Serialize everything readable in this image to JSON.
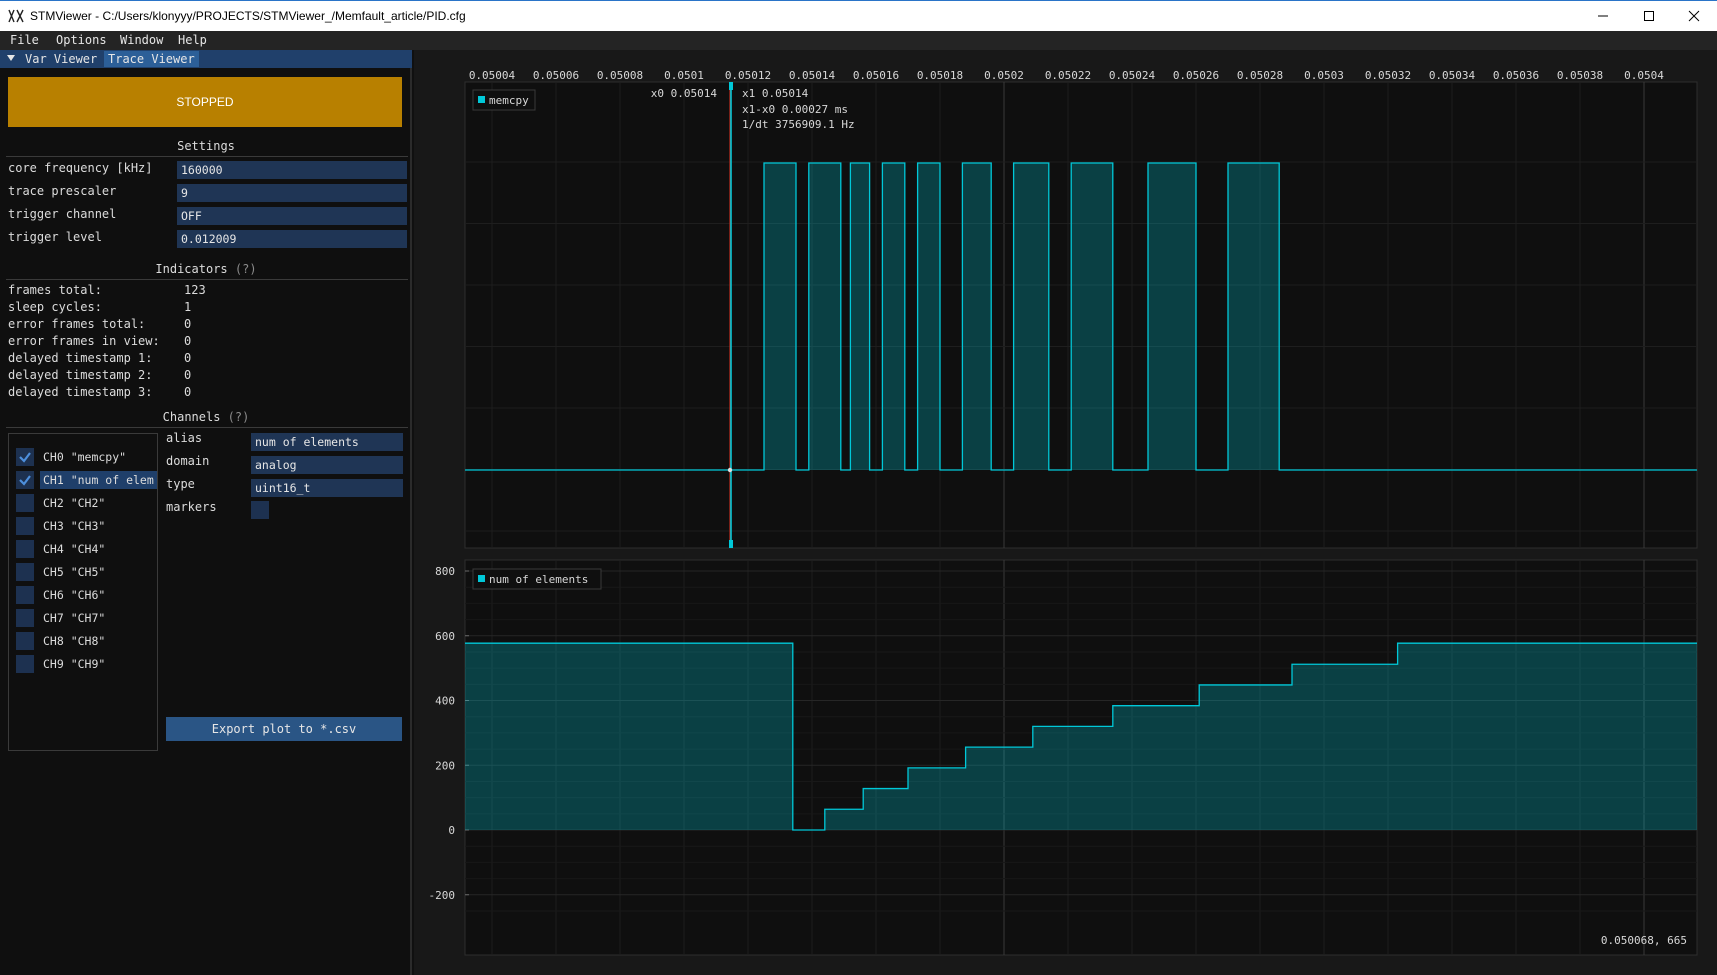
{
  "window": {
    "title": "STMViewer - C:/Users/klonyyy/PROJECTS/STMViewer_/Memfault_article/PID.cfg"
  },
  "menu": [
    "File",
    "Options",
    "Window",
    "Help"
  ],
  "tabs": [
    "Var Viewer",
    "Trace Viewer"
  ],
  "status_button": "STOPPED",
  "settings": {
    "header": "Settings",
    "rows": [
      {
        "label": "core frequency [kHz]",
        "value": "160000"
      },
      {
        "label": "trace prescaler",
        "value": "9"
      },
      {
        "label": "trigger channel",
        "value": "OFF"
      },
      {
        "label": "trigger level",
        "value": "0.012009"
      }
    ]
  },
  "indicators": {
    "header": "Indicators",
    "help": "(?)",
    "rows": [
      {
        "label": "frames total:",
        "value": "123"
      },
      {
        "label": "sleep cycles:",
        "value": "1"
      },
      {
        "label": "error frames total:",
        "value": "0"
      },
      {
        "label": "error frames in view:",
        "value": "0"
      },
      {
        "label": "delayed timestamp 1:",
        "value": "0"
      },
      {
        "label": "delayed timestamp 2:",
        "value": "0"
      },
      {
        "label": "delayed timestamp 3:",
        "value": "0"
      }
    ]
  },
  "channels": {
    "header": "Channels",
    "help": "(?)",
    "list": [
      {
        "label": "CH0 \"memcpy\"",
        "checked": true
      },
      {
        "label": "CH1 \"num of elem",
        "checked": true
      },
      {
        "label": "CH2 \"CH2\"",
        "checked": false
      },
      {
        "label": "CH3 \"CH3\"",
        "checked": false
      },
      {
        "label": "CH4 \"CH4\"",
        "checked": false
      },
      {
        "label": "CH5 \"CH5\"",
        "checked": false
      },
      {
        "label": "CH6 \"CH6\"",
        "checked": false
      },
      {
        "label": "CH7 \"CH7\"",
        "checked": false
      },
      {
        "label": "CH8 \"CH8\"",
        "checked": false
      },
      {
        "label": "CH9 \"CH9\"",
        "checked": false
      }
    ],
    "props": {
      "alias_label": "alias",
      "alias_value": "num of elements",
      "domain_label": "domain",
      "domain_value": "analog",
      "type_label": "type",
      "type_value": "uint16_t",
      "markers_label": "markers",
      "markers_checked": false
    },
    "export_label": "Export plot to *.csv"
  },
  "plots": {
    "x_ticks": [
      "0.05004",
      "0.05006",
      "0.05008",
      "0.0501",
      "0.05012",
      "0.05014",
      "0.05016",
      "0.05018",
      "0.0502",
      "0.05022",
      "0.05024",
      "0.05026",
      "0.05028",
      "0.0503",
      "0.05032",
      "0.05034",
      "0.05036",
      "0.05038",
      "0.0504"
    ],
    "cursor_x0": "x0 0.05014",
    "cursor_x1": "x1 0.05014",
    "cursor_dx": "x1-x0 0.00027 ms",
    "cursor_freq": "1/dt 3756909.1 Hz",
    "mouse_readout": "0.050068, 665",
    "accent": "#00c8d8",
    "cursor_color": "#e03020"
  },
  "chart_data": [
    {
      "type": "line",
      "title": "",
      "xlabel": "",
      "ylabel": "",
      "series": [
        {
          "name": "memcpy",
          "x": [
            0.050125,
            0.050135,
            0.050139,
            0.050149,
            0.050152,
            0.050158,
            0.050162,
            0.050169,
            0.050173,
            0.05018,
            0.050187,
            0.050196,
            0.050203,
            0.050214,
            0.050221,
            0.050234,
            0.050245,
            0.05026,
            0.05027,
            0.050286
          ],
          "y": [
            1,
            0,
            1,
            0,
            1,
            0,
            1,
            0,
            1,
            0,
            1,
            0,
            1,
            0,
            1,
            0,
            1,
            0,
            1,
            0
          ]
        }
      ]
    },
    {
      "type": "area",
      "title": "",
      "xlabel": "",
      "ylabel": "",
      "ylim": [
        -300,
        800
      ],
      "y_ticks": [
        800,
        600,
        400,
        200,
        0,
        -200
      ],
      "series": [
        {
          "name": "num of elements",
          "x": [
            0.05003,
            0.050134,
            0.050144,
            0.050156,
            0.05017,
            0.050188,
            0.050209,
            0.050234,
            0.050261,
            0.05029,
            0.050323,
            0.05042
          ],
          "y": [
            577,
            0,
            64,
            128,
            192,
            256,
            320,
            384,
            448,
            512,
            577,
            577
          ]
        }
      ]
    }
  ]
}
